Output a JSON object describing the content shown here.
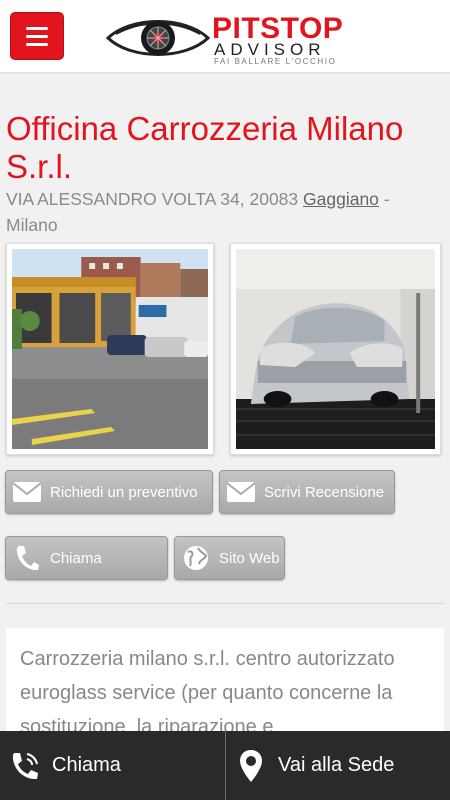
{
  "header": {
    "menu_icon": "hamburger-menu-icon",
    "logo": {
      "brand": "PITSTOP",
      "sub": "ADVISOR",
      "tagline": "FAI BALLARE L'OCCHIO",
      "icon": "eye-wheel-logo-icon"
    }
  },
  "business": {
    "name": "Officina Carrozzeria Milano S.r.l.",
    "address_prefix": "VIA ALESSANDRO VOLTA 34, 20083 ",
    "city": "Gaggiano",
    "address_suffix": " - Milano"
  },
  "photos": [
    {
      "subject": "officina-exterior"
    },
    {
      "subject": "car-in-paint-booth"
    }
  ],
  "actions": {
    "preventivo": {
      "label": "Richiedi un preventivo",
      "icon": "envelope-icon"
    },
    "recensione": {
      "label": "Scrivi Recensione",
      "icon": "envelope-icon"
    },
    "chiama": {
      "label": "Chiama",
      "icon": "phone-icon"
    },
    "sito": {
      "label": "Sito Web",
      "icon": "globe-icon"
    }
  },
  "description": "Carrozzeria milano s.r.l. centro autorizzato euroglass service (per quanto concerne la sostituzione, la riparazione e",
  "bottom_bar": {
    "chiama": {
      "label": "Chiama",
      "icon": "phone-call-icon"
    },
    "sede": {
      "label": "Vai alla Sede",
      "icon": "map-pin-icon"
    }
  },
  "colors": {
    "accent": "#e2151f",
    "bar": "#2a2a2a",
    "button": "#b4b4b4"
  }
}
